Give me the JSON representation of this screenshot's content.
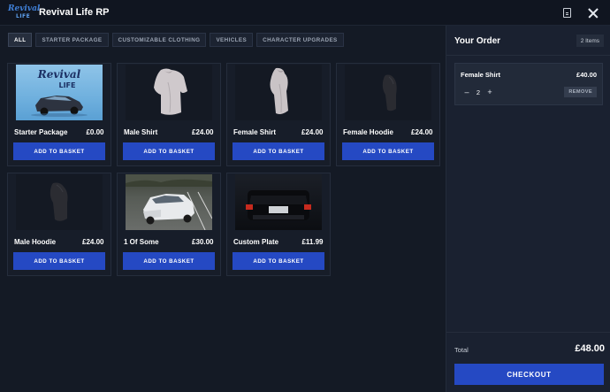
{
  "app": {
    "title": "Revival Life RP",
    "logo_top": "Revival",
    "logo_bottom": "LIFE"
  },
  "colors": {
    "accent": "#2549c3",
    "background": "#141a25",
    "panel": "#1a2130"
  },
  "tabs": [
    {
      "label": "ALL",
      "active": true
    },
    {
      "label": "STARTER PACKAGE"
    },
    {
      "label": "CUSTOMIZABLE CLOTHING"
    },
    {
      "label": "VEHICLES"
    },
    {
      "label": "CHARACTER UPGRADES"
    }
  ],
  "products": [
    {
      "name": "Starter Package",
      "price": "£0.00",
      "button": "ADD TO BASKET",
      "image_text_top": "Revival",
      "image_text_bottom": "LIFE"
    },
    {
      "name": "Male Shirt",
      "price": "£24.00",
      "button": "ADD TO BASKET"
    },
    {
      "name": "Female Shirt",
      "price": "£24.00",
      "button": "ADD TO BASKET"
    },
    {
      "name": "Female Hoodie",
      "price": "£24.00",
      "button": "ADD TO BASKET"
    },
    {
      "name": "Male Hoodie",
      "price": "£24.00",
      "button": "ADD TO BASKET"
    },
    {
      "name": "1 Of Some",
      "price": "£30.00",
      "button": "ADD TO BASKET"
    },
    {
      "name": "Custom Plate",
      "price": "£11.99",
      "button": "ADD TO BASKET"
    }
  ],
  "order": {
    "title": "Your Order",
    "count": "2 Items",
    "items": [
      {
        "name": "Female Shirt",
        "price": "£40.00",
        "qty": "2",
        "minus": "–",
        "plus": "+",
        "remove": "REMOVE"
      }
    ],
    "total_label": "Total",
    "total": "£48.00",
    "checkout": "CHECKOUT"
  }
}
